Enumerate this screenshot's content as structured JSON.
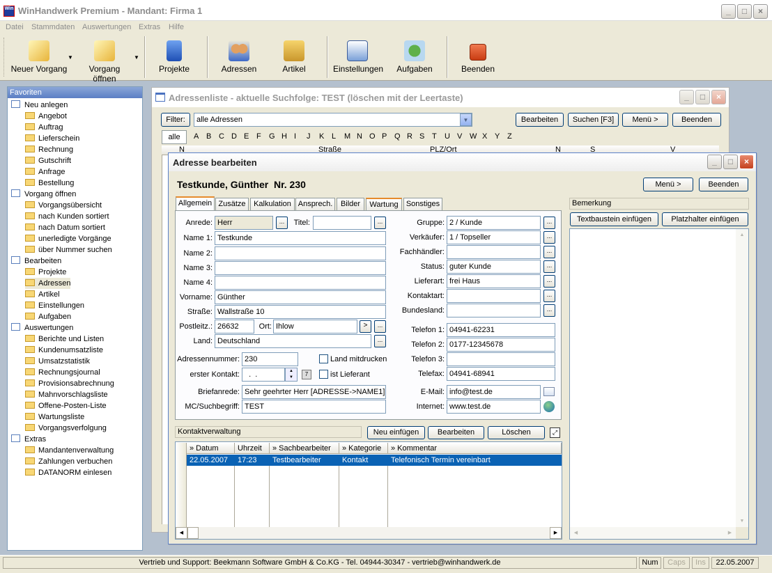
{
  "app": {
    "title": "WinHandwerk Premium - Mandant: Firma 1",
    "logo_text": "Win",
    "menu": [
      "Datei",
      "Stammdaten",
      "Auswertungen",
      "Extras",
      "Hilfe"
    ]
  },
  "toolbar": {
    "new": "Neuer Vorgang",
    "open": "Vorgang öffnen",
    "projects": "Projekte",
    "addresses": "Adressen",
    "articles": "Artikel",
    "settings": "Einstellungen",
    "tasks": "Aufgaben",
    "quit": "Beenden"
  },
  "sidebar": {
    "title": "Favoriten",
    "groups": [
      {
        "label": "Neu anlegen",
        "items": [
          "Angebot",
          "Auftrag",
          "Lieferschein",
          "Rechnung",
          "Gutschrift",
          "Anfrage",
          "Bestellung"
        ]
      },
      {
        "label": "Vorgang öffnen",
        "items": [
          "Vorgangsübersicht",
          "nach Kunden sortiert",
          "nach Datum sortiert",
          "unerledigte Vorgänge",
          "über Nummer suchen"
        ]
      },
      {
        "label": "Bearbeiten",
        "items": [
          "Projekte",
          "Adressen",
          "Artikel",
          "Einstellungen",
          "Aufgaben"
        ]
      },
      {
        "label": "Auswertungen",
        "items": [
          "Berichte und Listen",
          "Kundenumsatzliste",
          "Umsatzstatistik",
          "Rechnungsjournal",
          "Provisionsabrechnung",
          "Mahnvorschlagsliste",
          "Offene-Posten-Liste",
          "Wartungsliste",
          "Vorgangsverfolgung"
        ]
      },
      {
        "label": "Extras",
        "items": [
          "Mandantenverwaltung",
          "Zahlungen verbuchen",
          "DATANORM einlesen"
        ]
      }
    ]
  },
  "addrlist": {
    "title": "Adressenliste - aktuelle Suchfolge: TEST (löschen mit der Leertaste)",
    "filter_label": "Filter:",
    "filter_value": "alle Adressen",
    "edit": "Bearbeiten",
    "search": "Suchen [F3]",
    "menu": "Menü >",
    "quit": "Beenden",
    "all": "alle",
    "letters": [
      "A",
      "B",
      "C",
      "D",
      "E",
      "F",
      "G",
      "H",
      "I",
      "J",
      "K",
      "L",
      "M",
      "N",
      "O",
      "P",
      "Q",
      "R",
      "S",
      "T",
      "U",
      "V",
      "W",
      "X",
      "Y",
      "Z"
    ],
    "cols": [
      "N",
      "Straße",
      "PLZ/Ort",
      "N",
      "S",
      "V"
    ]
  },
  "editor": {
    "title": "Adresse bearbeiten",
    "heading": "Testkunde, Günther  Nr. 230",
    "menu": "Menü >",
    "quit": "Beenden",
    "tabs": [
      "Allgemein",
      "Zusätze",
      "Kalkulation",
      "Ansprech.",
      "Bilder",
      "Wartung",
      "Sonstiges"
    ],
    "dots": "...",
    "labels": {
      "anrede": "Anrede:",
      "titel": "Titel:",
      "name1": "Name 1:",
      "name2": "Name 2:",
      "name3": "Name 3:",
      "name4": "Name 4:",
      "vorname": "Vorname:",
      "strasse": "Straße:",
      "plz": "Postleitz.:",
      "ort": "Ort:",
      "land": "Land:",
      "adrnr": "Adressennummer:",
      "kontakt": "erster Kontakt:",
      "brief": "Briefanrede:",
      "mc": "MC/Suchbegriff:",
      "land_print": "Land mitdrucken",
      "lieferant": "ist Lieferant",
      "gruppe": "Gruppe:",
      "verkaeufer": "Verkäufer:",
      "fachhaendler": "Fachhändler:",
      "status": "Status:",
      "lieferart": "Lieferart:",
      "kontaktart": "Kontaktart:",
      "bundesland": "Bundesland:",
      "tel1": "Telefon 1:",
      "tel2": "Telefon 2:",
      "tel3": "Telefon 3:",
      "fax": "Telefax:",
      "email": "E-Mail:",
      "internet": "Internet:"
    },
    "values": {
      "anrede": "Herr",
      "titel": "",
      "name1": "Testkunde",
      "name2": "",
      "name3": "",
      "name4": "",
      "vorname": "Günther",
      "strasse": "Wallstraße 10",
      "plz": "26632",
      "ort": "Ihlow",
      "land": "Deutschland",
      "adrnr": "230",
      "kontakt": "  .  .",
      "brief": "Sehr geehrter Herr [ADRESSE->NAME1],",
      "mc": "TEST",
      "gruppe": "2 / Kunde",
      "verkaeufer": "1 / Topseller",
      "fachhaendler": "",
      "status": "guter Kunde",
      "lieferart": "frei Haus",
      "kontaktart": "",
      "bundesland": "",
      "tel1": "04941-62231",
      "tel2": "0177-12345678",
      "tel3": "",
      "fax": "04941-68941",
      "email": "info@test.de",
      "internet": "www.test.de"
    },
    "remark": {
      "title": "Bemerkung",
      "insert_text": "Textbaustein einfügen",
      "insert_placeholder": "Platzhalter einfügen"
    },
    "contacts": {
      "title": "Kontaktverwaltung",
      "new": "Neu einfügen",
      "edit": "Bearbeiten",
      "delete": "Löschen",
      "cols": [
        "» Datum",
        "Uhrzeit",
        "» Sachbearbeiter",
        "» Kategorie",
        "» Kommentar"
      ],
      "rows": [
        [
          "22.05.2007",
          "17:23",
          "Testbearbeiter",
          "Kontakt",
          "Telefonisch Termin vereinbart"
        ]
      ]
    }
  },
  "statusbar": {
    "support": "Vertrieb und Support: Beekmann Software GmbH & Co.KG - Tel. 04944-30347 - vertrieb@winhandwerk.de",
    "num": "Num",
    "caps": "Caps",
    "ins": "Ins",
    "date": "22.05.2007"
  }
}
